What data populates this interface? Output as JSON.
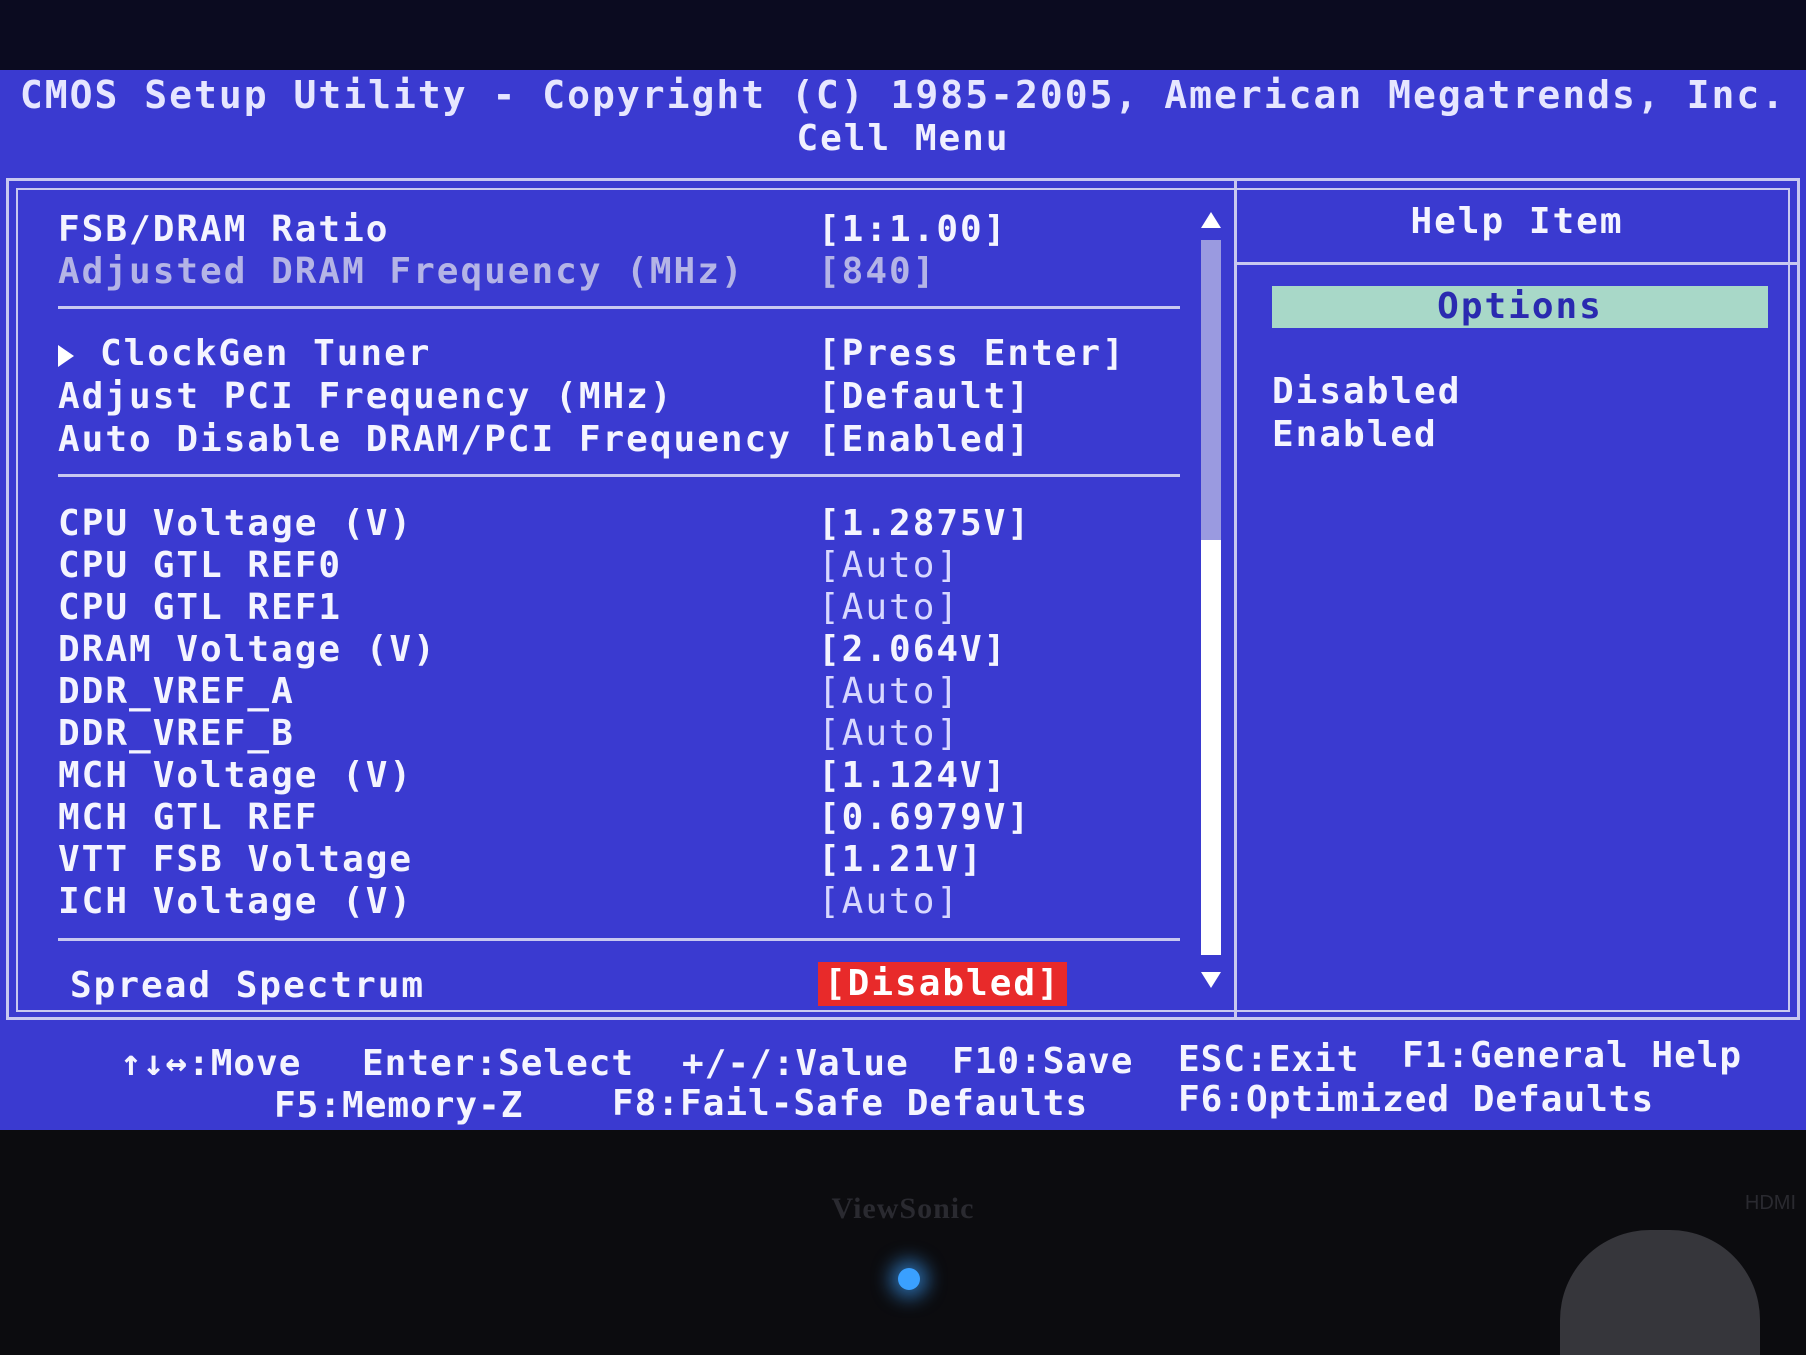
{
  "header": {
    "title": "CMOS Setup Utility - Copyright (C) 1985-2005, American Megatrends, Inc.",
    "subtitle": "Cell Menu"
  },
  "settings": [
    {
      "label": "FSB/DRAM Ratio",
      "value": "[1:1.00]"
    },
    {
      "label": "Adjusted DRAM Frequency (MHz)",
      "value": "[840]"
    },
    {
      "label": "ClockGen Tuner",
      "value": "[Press Enter]"
    },
    {
      "label": "Adjust PCI Frequency (MHz)",
      "value": "[Default]"
    },
    {
      "label": "Auto Disable DRAM/PCI Frequency",
      "value": "[Enabled]"
    },
    {
      "label": "CPU Voltage (V)",
      "value": "[1.2875V]"
    },
    {
      "label": "CPU GTL REF0",
      "value": "[Auto]"
    },
    {
      "label": "CPU GTL REF1",
      "value": "[Auto]"
    },
    {
      "label": "DRAM Voltage (V)",
      "value": "[2.064V]"
    },
    {
      "label": "DDR_VREF_A",
      "value": "[Auto]"
    },
    {
      "label": "DDR_VREF_B",
      "value": "[Auto]"
    },
    {
      "label": "MCH Voltage (V)",
      "value": "[1.124V]"
    },
    {
      "label": "MCH GTL REF",
      "value": "[0.6979V]"
    },
    {
      "label": "VTT FSB Voltage",
      "value": "[1.21V]"
    },
    {
      "label": "ICH Voltage (V)",
      "value": "[Auto]"
    },
    {
      "label": "Spread Spectrum",
      "value": "[Disabled]"
    }
  ],
  "help": {
    "title": "Help Item",
    "options_header": "Options",
    "options": [
      "Disabled",
      "Enabled"
    ]
  },
  "footer": {
    "move": "↑↓↔:Move",
    "select": "Enter:Select",
    "value": "+/-/:Value",
    "save": "F10:Save",
    "exit": "ESC:Exit",
    "general_help": "F1:General Help",
    "memory_z": "F5:Memory-Z",
    "fail_safe": "F8:Fail-Safe Defaults",
    "optimized": "F6:Optimized Defaults"
  },
  "monitor": {
    "brand": "ViewSonic",
    "port_label": "HDMI"
  },
  "colors": {
    "background": "#3a3ad0",
    "selected": "#e82a2a",
    "options_bar": "#a8d8c8",
    "led": "#3aa0ff"
  }
}
